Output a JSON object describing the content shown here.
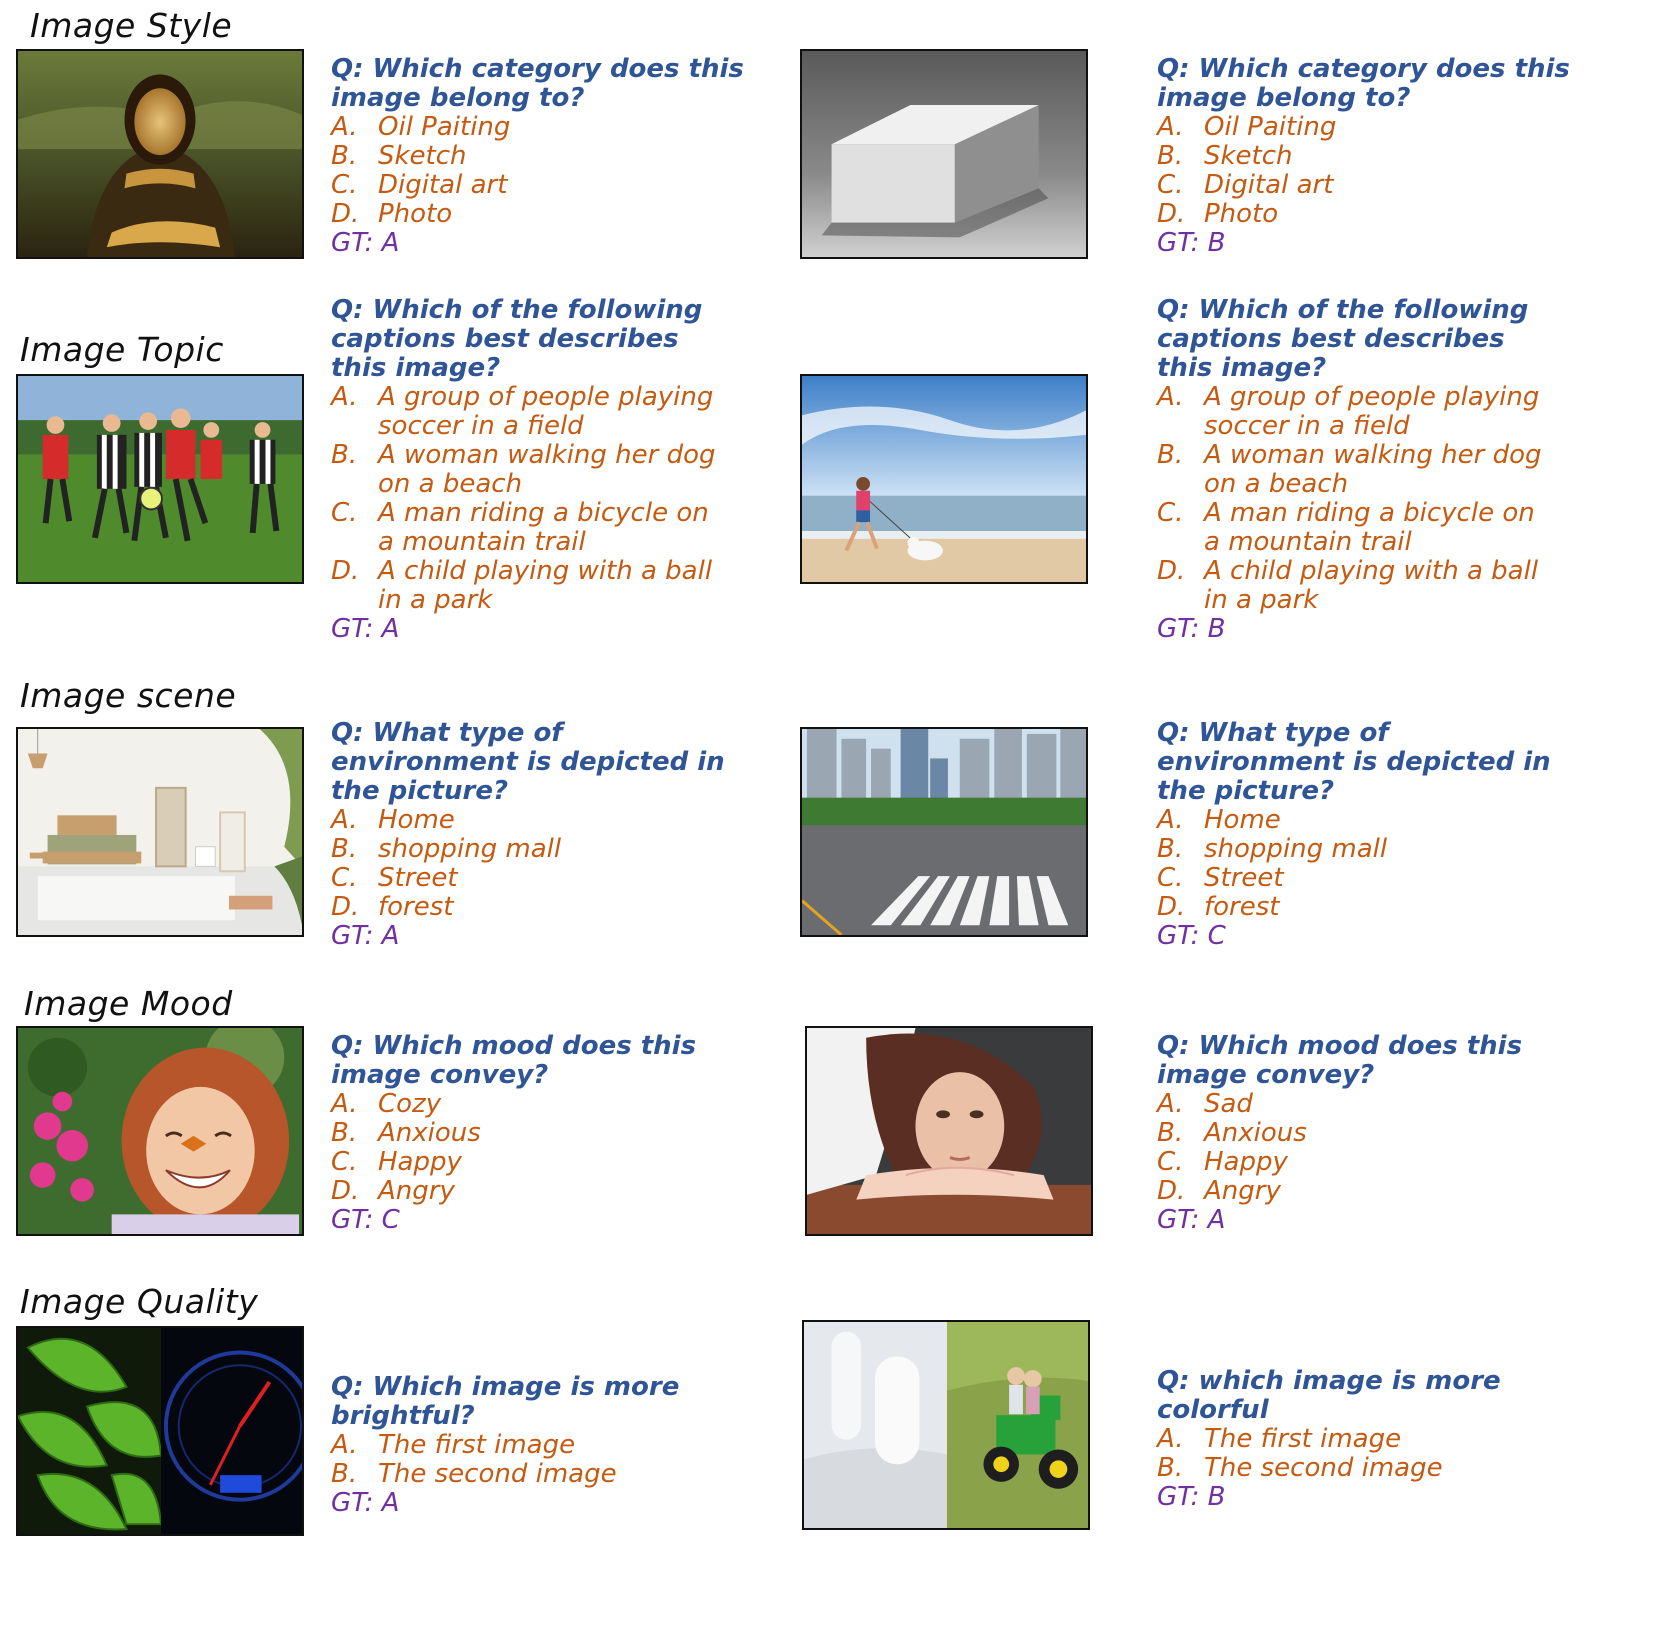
{
  "categories": {
    "style": "Image Style",
    "topic": "Image Topic",
    "scene": "Image scene",
    "mood": "Image Mood",
    "quality": "Image Quality"
  },
  "images": {
    "mona_lisa": "oil painting of a woman",
    "cube": "pencil sketch of a box",
    "soccer": "children playing soccer",
    "beach": "woman walking dog on beach",
    "living_room": "bright living room interior",
    "street": "city street with crosswalk",
    "girl_butterfly": "laughing girl with butterfly on nose",
    "sad_woman": "woman resting head on table",
    "leaves_speedo": "green leaves and dark speedometer",
    "white_tractor": "white stones and children on green toy tractor"
  },
  "style_left": {
    "q": "Q: Which category does this image belong to?",
    "options": [
      {
        "letter": "A.",
        "text": "Oil Paiting"
      },
      {
        "letter": "B.",
        "text": "Sketch"
      },
      {
        "letter": "C.",
        "text": "Digital art"
      },
      {
        "letter": "D.",
        "text": "Photo"
      }
    ],
    "gt": "GT: A"
  },
  "style_right": {
    "q": "Q: Which category does this image belong to?",
    "options": [
      {
        "letter": "A.",
        "text": "Oil Paiting"
      },
      {
        "letter": "B.",
        "text": "Sketch"
      },
      {
        "letter": "C.",
        "text": "Digital art"
      },
      {
        "letter": "D.",
        "text": "Photo"
      }
    ],
    "gt": "GT: B"
  },
  "topic_left": {
    "q": "Q: Which of the following captions best describes this image?",
    "options": [
      {
        "letter": "A.",
        "text": "A group of people playing soccer in a field"
      },
      {
        "letter": "B.",
        "text": "A woman walking her dog on a beach"
      },
      {
        "letter": "C.",
        "text": "A man riding a bicycle on a mountain trail"
      },
      {
        "letter": "D.",
        "text": "A child playing with a ball in a park"
      }
    ],
    "gt": "GT: A"
  },
  "topic_right": {
    "q": "Q: Which of the following captions best describes this image?",
    "options": [
      {
        "letter": "A.",
        "text": "A group of people playing soccer in a field"
      },
      {
        "letter": "B.",
        "text": "A woman walking her dog on a beach"
      },
      {
        "letter": "C.",
        "text": "A man riding a bicycle on a mountain trail"
      },
      {
        "letter": "D.",
        "text": "A child playing with a ball in a park"
      }
    ],
    "gt": "GT: B"
  },
  "scene_left": {
    "q": "Q: What type of environment is depicted in the picture?",
    "options": [
      {
        "letter": "A.",
        "text": "Home"
      },
      {
        "letter": "B.",
        "text": "shopping mall"
      },
      {
        "letter": "C.",
        "text": "Street"
      },
      {
        "letter": "D.",
        "text": "forest"
      }
    ],
    "gt": "GT: A"
  },
  "scene_right": {
    "q": "Q: What type of environment is depicted in the picture?",
    "options": [
      {
        "letter": "A.",
        "text": "Home"
      },
      {
        "letter": "B.",
        "text": "shopping mall"
      },
      {
        "letter": "C.",
        "text": "Street"
      },
      {
        "letter": "D.",
        "text": "forest"
      }
    ],
    "gt": "GT: C"
  },
  "mood_left": {
    "q": "Q: Which mood does this image convey?",
    "options": [
      {
        "letter": "A.",
        "text": "Cozy"
      },
      {
        "letter": "B.",
        "text": "Anxious"
      },
      {
        "letter": "C.",
        "text": "Happy"
      },
      {
        "letter": "D.",
        "text": "Angry"
      }
    ],
    "gt": "GT: C"
  },
  "mood_right": {
    "q": "Q: Which mood does this image convey?",
    "options": [
      {
        "letter": "A.",
        "text": "Sad"
      },
      {
        "letter": "B.",
        "text": "Anxious"
      },
      {
        "letter": "C.",
        "text": "Happy"
      },
      {
        "letter": "D.",
        "text": "Angry"
      }
    ],
    "gt": "GT: A"
  },
  "quality_left": {
    "q": "Q: Which image is more brightful?",
    "options": [
      {
        "letter": "A.",
        "text": "The first image"
      },
      {
        "letter": "B.",
        "text": "The second image"
      }
    ],
    "gt": "GT: A"
  },
  "quality_right": {
    "q": "Q: which image is more colorful",
    "options": [
      {
        "letter": "A.",
        "text": "The first image"
      },
      {
        "letter": "B.",
        "text": "The second image"
      }
    ],
    "gt": "GT: B"
  },
  "colors": {
    "question": "#2f5597",
    "option": "#c55a11",
    "gt": "#7030a0"
  }
}
